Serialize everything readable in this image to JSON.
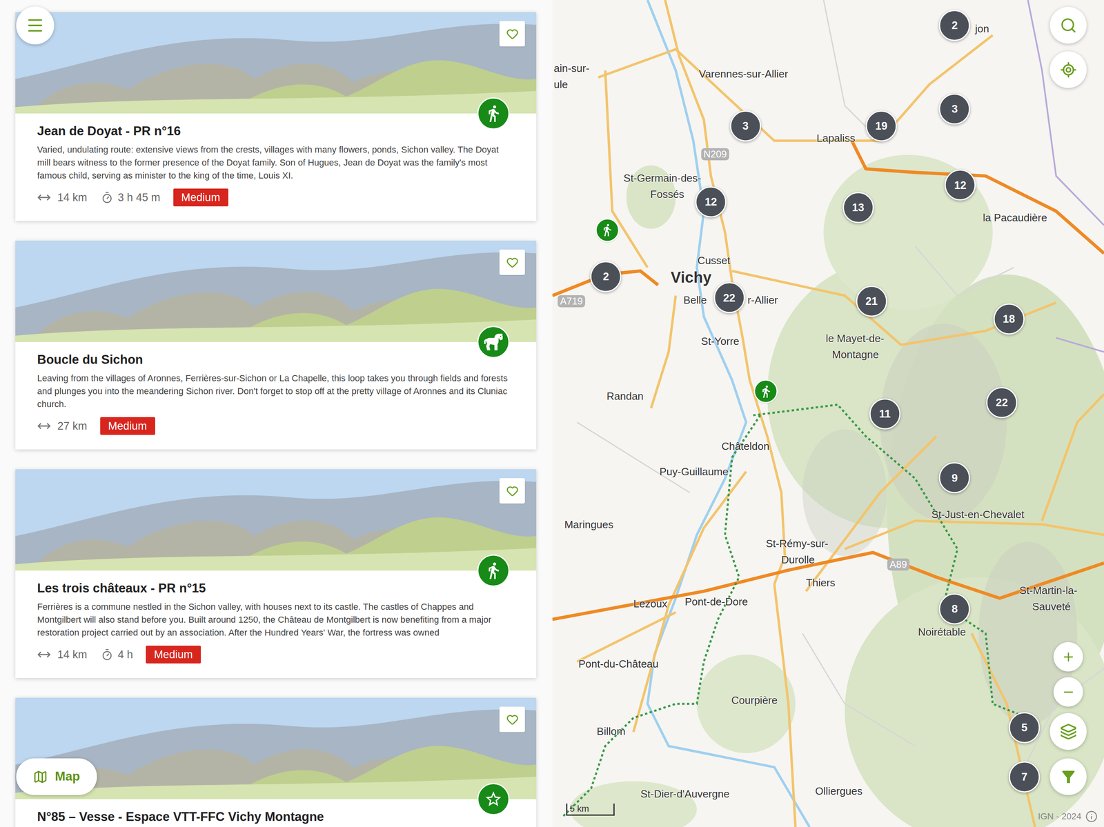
{
  "cards": [
    {
      "title": "Jean de Doyat - PR n°16",
      "description": "Varied, undulating route: extensive views from the crests, villages with many flowers, ponds, Sichon valley. The Doyat mill bears witness to the former presence of the Doyat family. Son of Hugues, Jean de Doyat was the family's most famous child, serving as minister to the king of the time, Louis XI.",
      "distance": "14 km",
      "duration": "3 h 45 m",
      "difficulty": "Medium",
      "kind": "hiking",
      "favorite": false
    },
    {
      "title": "Boucle du Sichon",
      "description": "Leaving from the villages of Aronnes, Ferrières-sur-Sichon or La Chapelle, this loop takes you through fields and forests and plunges you into the meandering Sichon river. Don't forget to stop off at the pretty village of Aronnes and its Cluniac church.",
      "distance": "27 km",
      "difficulty": "Medium",
      "kind": "horse",
      "favorite": false
    },
    {
      "title": "Les trois châteaux - PR n°15",
      "description": "Ferrières is a commune nestled in the Sichon valley, with houses next to its castle. The castles of Chappes and Montgilbert will also stand before you. Built around 1250, the Château de Montgilbert is now benefiting from a major restoration project carried out by an association. After the Hundred Years' War, the fortress was owned",
      "distance": "14 km",
      "duration": "4 h",
      "difficulty": "Medium",
      "kind": "hiking",
      "favorite": false
    },
    {
      "title": "N°85 – Vesse - Espace VTT-FFC Vichy Montagne",
      "kind": "star",
      "favorite": false
    }
  ],
  "map_button": {
    "label": "Map"
  },
  "map": {
    "clusters": [
      {
        "count": "2"
      },
      {
        "count": "3"
      },
      {
        "count": "19"
      },
      {
        "count": "3"
      },
      {
        "count": "12"
      },
      {
        "count": "12"
      },
      {
        "count": "13"
      },
      {
        "count": "2"
      },
      {
        "count": "22"
      },
      {
        "count": "21"
      },
      {
        "count": "18"
      },
      {
        "count": "22"
      },
      {
        "count": "11"
      },
      {
        "count": "9"
      },
      {
        "count": "8"
      },
      {
        "count": "5"
      },
      {
        "count": "7"
      }
    ],
    "pins": [
      {
        "kind": "hiking"
      },
      {
        "kind": "hiking"
      }
    ],
    "places": [
      {
        "label": "ain-sur-"
      },
      {
        "label": "ule"
      },
      {
        "label": "Varennes-sur-Allier"
      },
      {
        "label": "Lapaliss"
      },
      {
        "label": "jon"
      },
      {
        "label": "St-Germain-des-"
      },
      {
        "label": "Fossés"
      },
      {
        "label": "la Pacaudière"
      },
      {
        "label": "Cusset"
      },
      {
        "label": "Vichy"
      },
      {
        "label": "Belle"
      },
      {
        "label": "r-Allier"
      },
      {
        "label": "St-Yorre"
      },
      {
        "label": "Randan"
      },
      {
        "label": "le Mayet-de-"
      },
      {
        "label": "Montagne"
      },
      {
        "label": "Châteldon"
      },
      {
        "label": "Puy-Guillaume"
      },
      {
        "label": "Maringues"
      },
      {
        "label": "St-Just-en-Chevalet"
      },
      {
        "label": "St-Rémy-sur-"
      },
      {
        "label": "Durolle"
      },
      {
        "label": "Thiers"
      },
      {
        "label": "Lezoux"
      },
      {
        "label": "Pont-de-Dore"
      },
      {
        "label": "St-Martin-la-"
      },
      {
        "label": "Sauveté"
      },
      {
        "label": "Noirétable"
      },
      {
        "label": "Pont-du-Château"
      },
      {
        "label": "Courpière"
      },
      {
        "label": "Billom"
      },
      {
        "label": "St-Dier-d'Auvergne"
      },
      {
        "label": "Olliergues"
      }
    ],
    "roads": [
      {
        "label": "N209"
      },
      {
        "label": "A719"
      },
      {
        "label": "A89"
      }
    ],
    "scale": "5 km",
    "attribution": "IGN - 2024"
  }
}
